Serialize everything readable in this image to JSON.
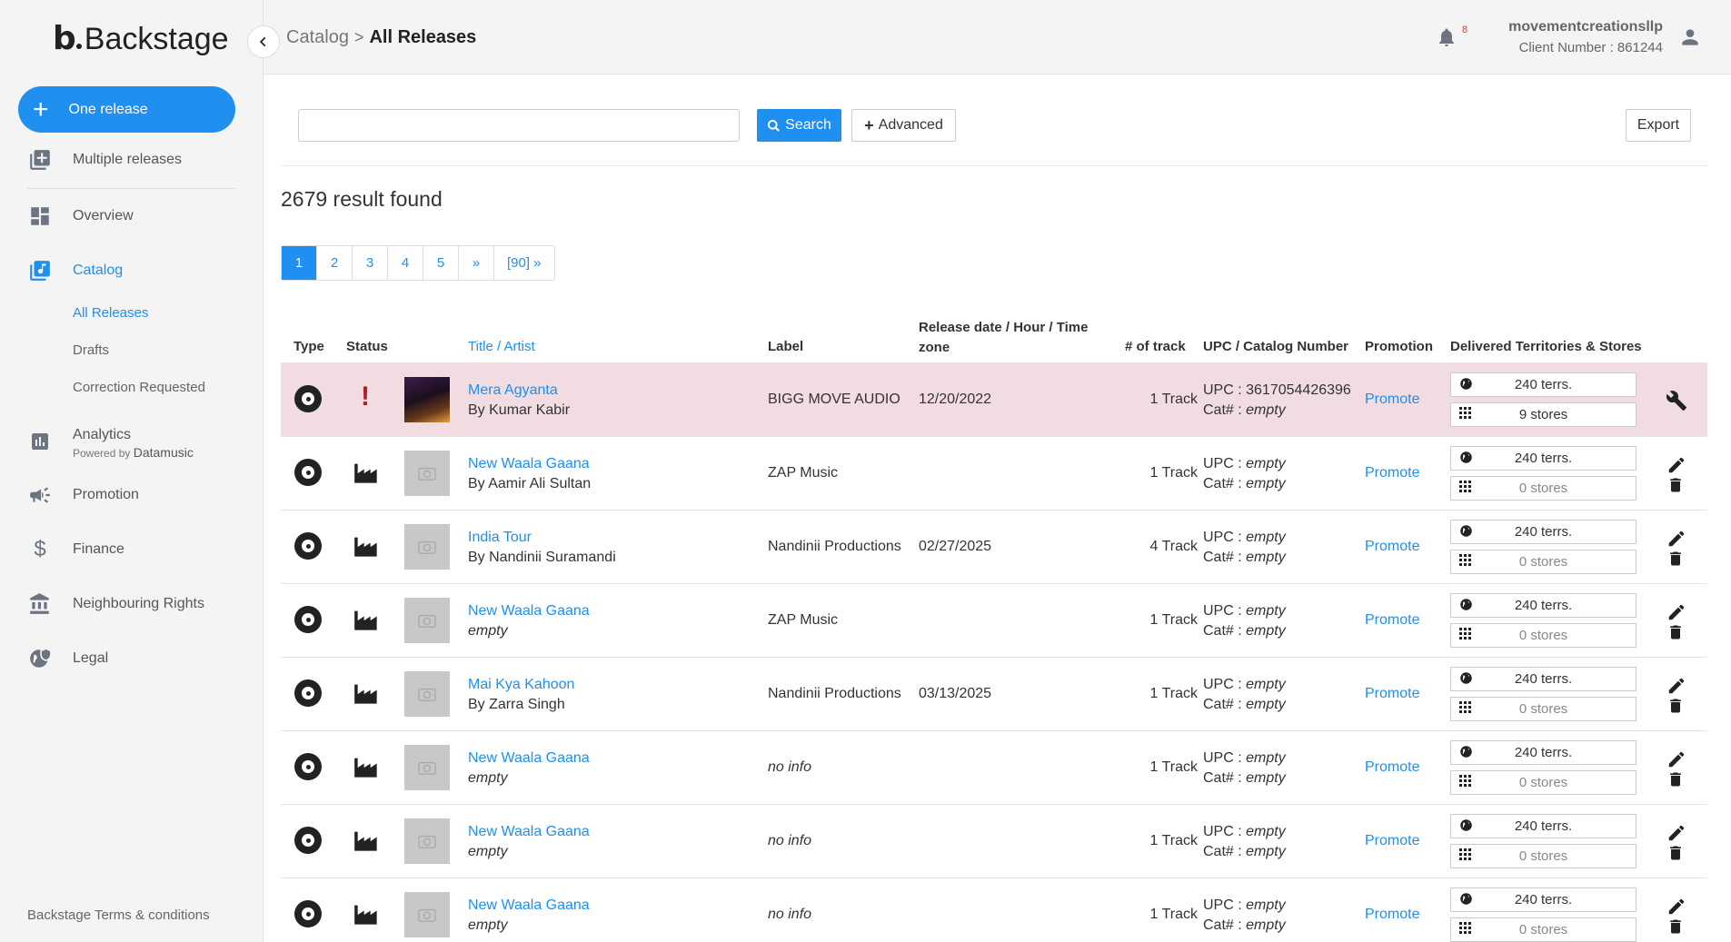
{
  "app": {
    "brand_letter": "b",
    "brand_name": "Backstage"
  },
  "sidebar": {
    "primary_button": "One release",
    "items": [
      {
        "label": "Multiple releases",
        "icon": "stack-add-icon"
      },
      {
        "label": "Overview",
        "icon": "dashboard-icon"
      },
      {
        "label": "Catalog",
        "icon": "music-library-icon",
        "active": true
      },
      {
        "label": "Analytics",
        "icon": "bar-chart-icon"
      },
      {
        "label": "Promotion",
        "icon": "megaphone-icon"
      },
      {
        "label": "Finance",
        "icon": "dollar-icon"
      },
      {
        "label": "Neighbouring Rights",
        "icon": "bank-icon"
      },
      {
        "label": "Legal",
        "icon": "globe-shield-icon"
      }
    ],
    "sub_items": [
      "All Releases",
      "Drafts",
      "Correction Requested"
    ],
    "powered_prefix": "Powered by",
    "powered_brand": "Datamusic",
    "terms": "Backstage Terms & conditions"
  },
  "header": {
    "breadcrumb_parent": "Catalog",
    "breadcrumb_sep": ">",
    "breadcrumb_current": "All Releases",
    "notification_count": "8",
    "username": "movementcreationsllp",
    "client_number": "Client Number : 861244"
  },
  "toolbar": {
    "search_value": "",
    "search_label": "Search",
    "advanced_label": "Advanced",
    "export_label": "Export"
  },
  "results": {
    "count_text": "2679 result found"
  },
  "pagination": {
    "pages": [
      "1",
      "2",
      "3",
      "4",
      "5",
      "»",
      "[90] »"
    ],
    "current": "1"
  },
  "table": {
    "headers": {
      "type": "Type",
      "status": "Status",
      "title_artist": "Title / Artist",
      "label": "Label",
      "release_date": "Release date / Hour / Time zone",
      "tracks": "# of track",
      "upc": "UPC / Catalog Number",
      "promotion": "Promotion",
      "delivered": "Delivered Territories & Stores"
    },
    "upc_prefix": "UPC :",
    "cat_prefix": "Cat# :",
    "promote_label": "Promote",
    "rows": [
      {
        "title": "Mera Agyanta",
        "artist": "By Kumar Kabir",
        "label": "BIGG MOVE AUDIO",
        "date": "12/20/2022",
        "tracks": "1 Track",
        "upc": "3617054426396",
        "cat": "empty",
        "terrs": "240 terrs.",
        "stores": "9 stores",
        "status": "error",
        "cover": true
      },
      {
        "title": "New Waala Gaana",
        "artist": "By Aamir Ali Sultan",
        "label": "ZAP Music",
        "date": "",
        "tracks": "1 Track",
        "upc": "empty",
        "cat": "empty",
        "terrs": "240 terrs.",
        "stores": "0 stores",
        "status": "draft"
      },
      {
        "title": "India Tour",
        "artist": "By Nandinii Suramandi",
        "label": "Nandinii Productions",
        "date": "02/27/2025",
        "tracks": "4 Track",
        "upc": "empty",
        "cat": "empty",
        "terrs": "240 terrs.",
        "stores": "0 stores",
        "status": "draft"
      },
      {
        "title": "New Waala Gaana",
        "artist": "empty",
        "label": "ZAP Music",
        "date": "",
        "tracks": "1 Track",
        "upc": "empty",
        "cat": "empty",
        "terrs": "240 terrs.",
        "stores": "0 stores",
        "status": "draft"
      },
      {
        "title": "Mai Kya Kahoon",
        "artist": "By Zarra Singh",
        "label": "Nandinii Productions",
        "date": "03/13/2025",
        "tracks": "1 Track",
        "upc": "empty",
        "cat": "empty",
        "terrs": "240 terrs.",
        "stores": "0 stores",
        "status": "draft"
      },
      {
        "title": "New Waala Gaana",
        "artist": "empty",
        "label": "no info",
        "date": "",
        "tracks": "1 Track",
        "upc": "empty",
        "cat": "empty",
        "terrs": "240 terrs.",
        "stores": "0 stores",
        "status": "draft"
      },
      {
        "title": "New Waala Gaana",
        "artist": "empty",
        "label": "no info",
        "date": "",
        "tracks": "1 Track",
        "upc": "empty",
        "cat": "empty",
        "terrs": "240 terrs.",
        "stores": "0 stores",
        "status": "draft"
      },
      {
        "title": "New Waala Gaana",
        "artist": "empty",
        "label": "no info",
        "date": "",
        "tracks": "1 Track",
        "upc": "empty",
        "cat": "empty",
        "terrs": "240 terrs.",
        "stores": "0 stores",
        "status": "draft"
      }
    ]
  },
  "colors": {
    "accent": "#1f8ff0",
    "flag_row": "#f1dde1",
    "error": "#b71c1c"
  }
}
